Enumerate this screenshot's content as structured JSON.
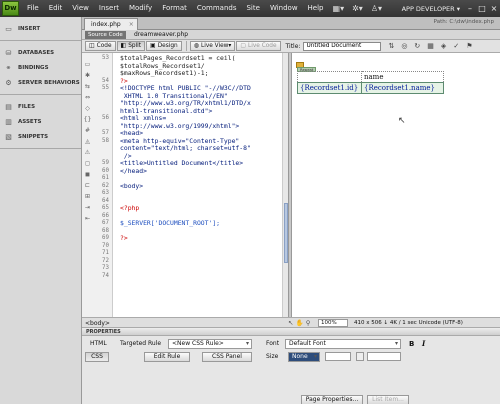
{
  "menubar": {
    "logo": "Dw",
    "items": [
      "File",
      "Edit",
      "View",
      "Insert",
      "Modify",
      "Format",
      "Commands",
      "Site",
      "Window",
      "Help"
    ],
    "icons": [
      "layout-icon",
      "gear-icon",
      "person-icon"
    ],
    "workspace": "APP DEVELOPER",
    "window_controls": [
      "minimize-icon",
      "maximize-icon",
      "close-icon"
    ]
  },
  "left_panel": {
    "groups": [
      {
        "items": [
          {
            "label": "INSERT",
            "icon": "insert-icon"
          }
        ]
      },
      {
        "items": [
          {
            "label": "DATABASES",
            "icon": "database-icon"
          },
          {
            "label": "BINDINGS",
            "icon": "bindings-icon"
          },
          {
            "label": "SERVER BEHAVIORS",
            "icon": "server-behaviors-icon"
          }
        ]
      },
      {
        "items": [
          {
            "label": "FILES",
            "icon": "files-icon"
          },
          {
            "label": "ASSETS",
            "icon": "assets-icon"
          },
          {
            "label": "SNIPPETS",
            "icon": "snippets-icon"
          }
        ]
      }
    ]
  },
  "document": {
    "tab": "index.php",
    "path": "Path: C:\\dw\\index.php",
    "source_code_label": "Source Code",
    "related_file": "dreamweaver.php"
  },
  "toolbar": {
    "code": "Code",
    "split": "Split",
    "design": "Design",
    "live_view": "Live View",
    "live_code": "Live Code",
    "title_label": "Title:",
    "title_value": "Untitled Document"
  },
  "code_lines": [
    {
      "num": "53",
      "text": "$totalPages_Recordset1 = ceil(",
      "color": "black"
    },
    {
      "num": "",
      "text": "$totalRows_Recordset1/",
      "color": "black"
    },
    {
      "num": "",
      "text": "$maxRows_Recordset1)-1;",
      "color": "black"
    },
    {
      "num": "54",
      "text": "?>",
      "color": "red"
    },
    {
      "num": "55",
      "text": "<!DOCTYPE html PUBLIC \"-//W3C//DTD",
      "color": "navy"
    },
    {
      "num": "",
      "text": " XHTML 1.0 Transitional//EN\"",
      "color": "navy"
    },
    {
      "num": "",
      "text": "\"http://www.w3.org/TR/xhtml1/DTD/x",
      "color": "navy"
    },
    {
      "num": "",
      "text": "html1-transitional.dtd\">",
      "color": "navy"
    },
    {
      "num": "56",
      "text": "<html xmlns=",
      "color": "navy"
    },
    {
      "num": "",
      "text": "\"http://www.w3.org/1999/xhtml\">",
      "color": "navy"
    },
    {
      "num": "57",
      "text": "<head>",
      "color": "navy"
    },
    {
      "num": "58",
      "text": "<meta http-equiv=\"Content-Type\"",
      "color": "navy"
    },
    {
      "num": "",
      "text": "content=\"text/html; charset=utf-8\"",
      "color": "navy"
    },
    {
      "num": "",
      "text": " />",
      "color": "navy"
    },
    {
      "num": "59",
      "text": "<title>Untitled Document</title>",
      "color": "navy"
    },
    {
      "num": "60",
      "text": "</head>",
      "color": "navy"
    },
    {
      "num": "61",
      "text": "",
      "color": "black"
    },
    {
      "num": "62",
      "text": "<body>",
      "color": "navy"
    },
    {
      "num": "63",
      "text": "",
      "color": "black"
    },
    {
      "num": "64",
      "text": "",
      "color": "black"
    },
    {
      "num": "65",
      "text": "<?php",
      "color": "red"
    },
    {
      "num": "66",
      "text": "",
      "color": "black"
    },
    {
      "num": "67",
      "text": "$_SERVER['DOCUMENT_ROOT'];",
      "color": "blue"
    },
    {
      "num": "68",
      "text": "",
      "color": "black"
    },
    {
      "num": "69",
      "text": "?>",
      "color": "red"
    },
    {
      "num": "70",
      "text": "",
      "color": "black"
    },
    {
      "num": "71",
      "text": "",
      "color": "black"
    },
    {
      "num": "72",
      "text": "",
      "color": "black"
    },
    {
      "num": "73",
      "text": "",
      "color": "black"
    },
    {
      "num": "74",
      "text": "",
      "color": "black"
    }
  ],
  "code_colors": {
    "black": "#222222",
    "navy": "#001a7a",
    "red": "#cc0000",
    "blue": "#1e4fbf"
  },
  "design_view": {
    "repeat_label": "Repeat",
    "header_row": [
      "",
      "name"
    ],
    "data_row": [
      "{Recordset1.id}",
      "{Recordset1.name}"
    ]
  },
  "statusbar": {
    "tag": "<body>",
    "zoom": "100%",
    "info": "410 x 506 ↓ 4K / 1 sec  Unicode (UTF-8)"
  },
  "properties": {
    "header": "PROPERTIES",
    "html_btn": "HTML",
    "css_btn": "CSS",
    "targeted_rule_label": "Targeted Rule",
    "targeted_rule_value": "<New CSS Rule>",
    "edit_rule": "Edit Rule",
    "css_panel": "CSS Panel",
    "font_label": "Font",
    "font_value": "Default Font",
    "size_label": "Size",
    "size_value": "None",
    "bold": "B",
    "italic": "I",
    "page_properties": "Page Properties...",
    "list_item": "List Item..."
  }
}
